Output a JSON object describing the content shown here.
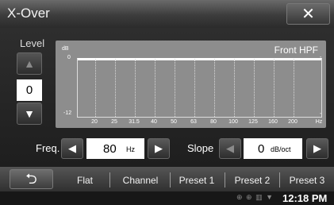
{
  "window": {
    "title": "X-Over",
    "close_icon": "✕"
  },
  "level": {
    "label": "Level",
    "value": "0",
    "up_icon": "▲",
    "down_icon": "▼"
  },
  "graph": {
    "title": "Front HPF",
    "y_unit": "dB",
    "y_top": "0",
    "y_bottom": "-12",
    "x_unit": "Hz",
    "x_ticks": [
      "20",
      "25",
      "31.5",
      "40",
      "50",
      "63",
      "80",
      "100",
      "125",
      "160",
      "200"
    ],
    "right_marks": [
      "-",
      "-"
    ]
  },
  "freq": {
    "label": "Freq.",
    "value": "80",
    "unit": "Hz",
    "left_icon": "◀",
    "right_icon": "▶"
  },
  "slope": {
    "label": "Slope",
    "value": "0",
    "unit": "dB/oct",
    "left_icon": "◀",
    "right_icon": "▶"
  },
  "bottom": {
    "back_icon": "⮌",
    "tabs": [
      "Flat",
      "Channel",
      "Preset 1",
      "Preset 2",
      "Preset 3"
    ]
  },
  "status": {
    "icons": "⊕ ⊕ ▥ ▼",
    "time": "12:18 PM"
  }
}
